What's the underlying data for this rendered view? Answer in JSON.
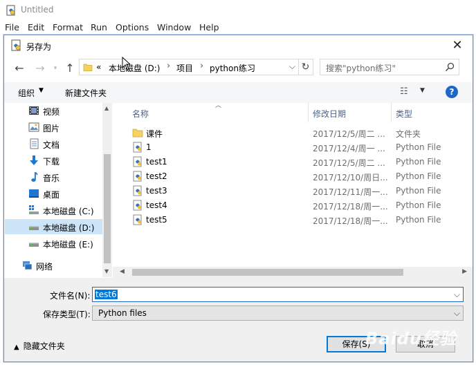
{
  "idle": {
    "title": "Untitled",
    "menu": [
      "File",
      "Edit",
      "Format",
      "Run",
      "Options",
      "Window",
      "Help"
    ]
  },
  "dialog": {
    "title": "另存为",
    "address": {
      "overflow": "«",
      "segments": [
        "本地磁盘 (D:)",
        "项目",
        "python练习"
      ]
    },
    "search_placeholder": "搜索\"python练习\"",
    "toolbar": {
      "organize": "组织",
      "new_folder": "新建文件夹"
    },
    "nav_items": [
      {
        "label": "视频",
        "icon": "video-icon"
      },
      {
        "label": "图片",
        "icon": "pictures-icon"
      },
      {
        "label": "文档",
        "icon": "documents-icon"
      },
      {
        "label": "下载",
        "icon": "download-icon"
      },
      {
        "label": "音乐",
        "icon": "music-icon"
      },
      {
        "label": "桌面",
        "icon": "desktop-icon"
      },
      {
        "label": "本地磁盘 (C:)",
        "icon": "drive-icon"
      },
      {
        "label": "本地磁盘 (D:)",
        "icon": "drive-icon",
        "selected": true
      },
      {
        "label": "本地磁盘 (E:)",
        "icon": "drive-icon"
      },
      {
        "label": "网络",
        "icon": "network-icon"
      }
    ],
    "columns": {
      "name": "名称",
      "date": "修改日期",
      "type": "类型"
    },
    "files": [
      {
        "name": "课件",
        "date": "2017/12/5/周二 ...",
        "type": "文件夹",
        "kind": "folder"
      },
      {
        "name": "1",
        "date": "2017/12/4/周一 ...",
        "type": "Python File",
        "kind": "python"
      },
      {
        "name": "test1",
        "date": "2017/12/5/周二 ...",
        "type": "Python File",
        "kind": "python"
      },
      {
        "name": "test2",
        "date": "2017/12/10/周日...",
        "type": "Python File",
        "kind": "python"
      },
      {
        "name": "test3",
        "date": "2017/12/11/周一...",
        "type": "Python File",
        "kind": "python"
      },
      {
        "name": "test4",
        "date": "2017/12/18/周一...",
        "type": "Python File",
        "kind": "python"
      },
      {
        "name": "test5",
        "date": "2017/12/18/周一...",
        "type": "Python File",
        "kind": "python"
      }
    ],
    "form": {
      "filename_label": "文件名(N):",
      "filename_value": "test6",
      "filetype_label": "保存类型(T):",
      "filetype_value": "Python files",
      "hide_folders": "隐藏文件夹",
      "save": "保存(S)",
      "cancel": "取消"
    }
  },
  "watermark": "Baidu经验"
}
